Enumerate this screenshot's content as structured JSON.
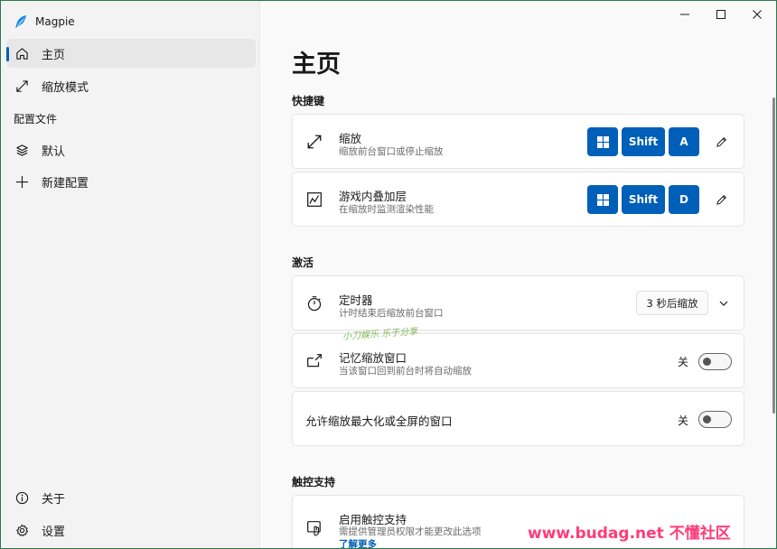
{
  "app": {
    "name": "Magpie",
    "accent": "#005fb8"
  },
  "window_controls": {
    "minimize": "minimize-icon",
    "maximize": "maximize-icon",
    "close": "close-icon"
  },
  "sidebar": {
    "items": [
      {
        "label": "主页",
        "icon": "home-icon",
        "selected": true
      },
      {
        "label": "缩放模式",
        "icon": "expand-icon",
        "selected": false
      }
    ],
    "profiles_header": "配置文件",
    "profiles": [
      {
        "label": "默认",
        "icon": "layers-icon"
      },
      {
        "label": "新建配置",
        "icon": "plus-icon"
      }
    ],
    "footer": [
      {
        "label": "关于",
        "icon": "info-icon"
      },
      {
        "label": "设置",
        "icon": "gear-icon"
      }
    ]
  },
  "main": {
    "title": "主页",
    "shortcuts": {
      "header": "快捷键",
      "items": [
        {
          "title": "缩放",
          "desc": "缩放前台窗口或停止缩放",
          "keys": [
            "⊞",
            "Shift",
            "A"
          ]
        },
        {
          "title": "游戏内叠加层",
          "desc": "在缩放时监测渲染性能",
          "keys": [
            "⊞",
            "Shift",
            "D"
          ]
        }
      ]
    },
    "activation": {
      "header": "激活",
      "timer": {
        "title": "定时器",
        "desc": "计时结束后缩放前台窗口",
        "value": "3 秒后缩放"
      },
      "remember": {
        "title": "记忆缩放窗口",
        "desc": "当该窗口回到前台时将自动缩放",
        "state": "关",
        "on": false
      },
      "allow_max": {
        "title": "允许缩放最大化或全屏的窗口",
        "state": "关",
        "on": false
      }
    },
    "touch": {
      "header": "触控支持",
      "enable": {
        "title": "启用触控支持",
        "desc": "需提供管理员权限才能更改此选项",
        "link": "了解更多"
      }
    }
  },
  "watermarks": {
    "middle": "小刀娱乐 乐于分享",
    "corner": "www.budag.net 不懂社区"
  }
}
